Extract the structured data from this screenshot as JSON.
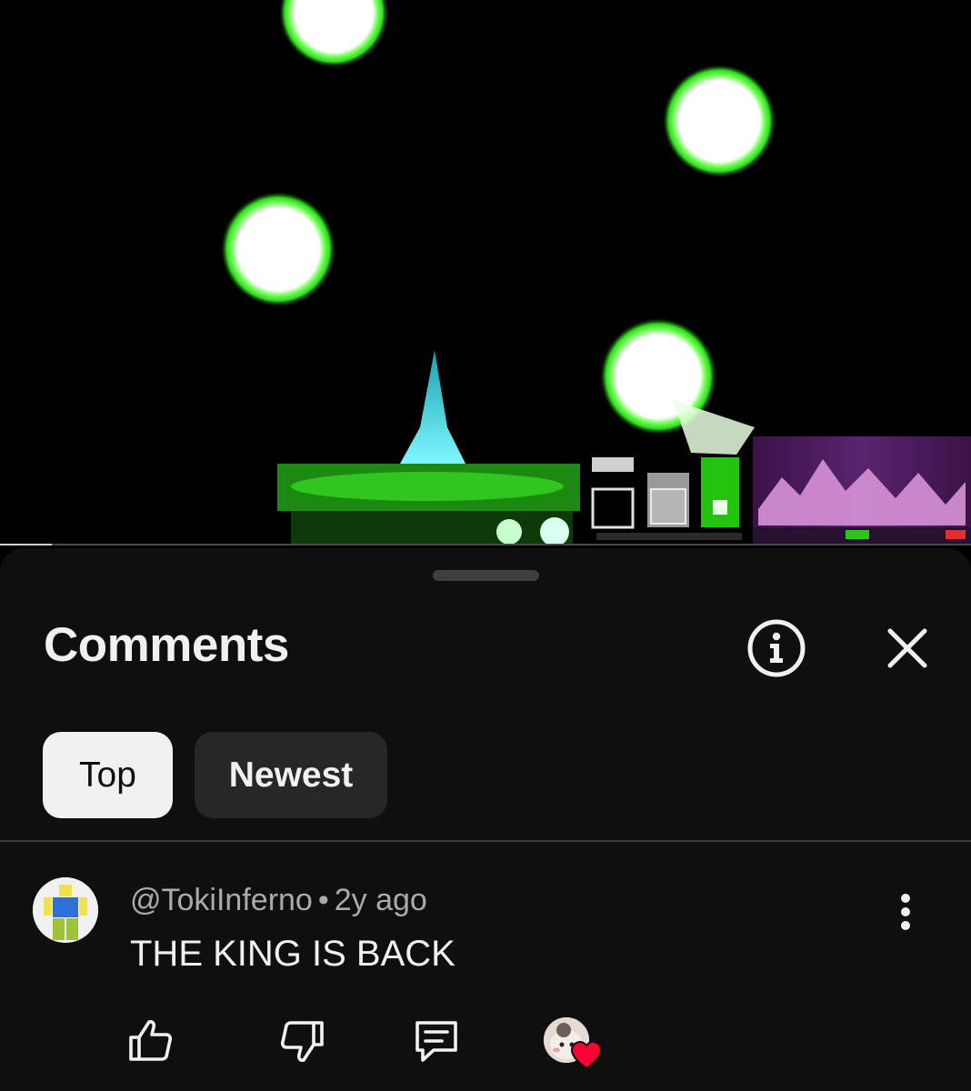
{
  "video": {
    "progress_fraction": 0.053
  },
  "comments_panel": {
    "title": "Comments",
    "filters": [
      {
        "label": "Top",
        "selected": true
      },
      {
        "label": "Newest",
        "selected": false
      }
    ],
    "comment": {
      "author": "@TokiInferno",
      "separator": "•",
      "age": "2y ago",
      "text": "THE KING IS BACK",
      "liked_by_creator": true
    }
  },
  "icons": {
    "info": "info-icon",
    "close": "close-icon",
    "more": "more-vertical-icon",
    "like": "thumbs-up-icon",
    "dislike": "thumbs-down-icon",
    "reply": "reply-icon",
    "heart": "heart-icon"
  },
  "colors": {
    "sheet_bg": "#0f0f0f",
    "chip_selected_bg": "#f1f1f1",
    "chip_bg": "#272727",
    "text_primary": "#f1f1f1",
    "text_secondary": "#aaaaaa",
    "heart": "#ff0033",
    "video_glow": "#3cff2e"
  }
}
